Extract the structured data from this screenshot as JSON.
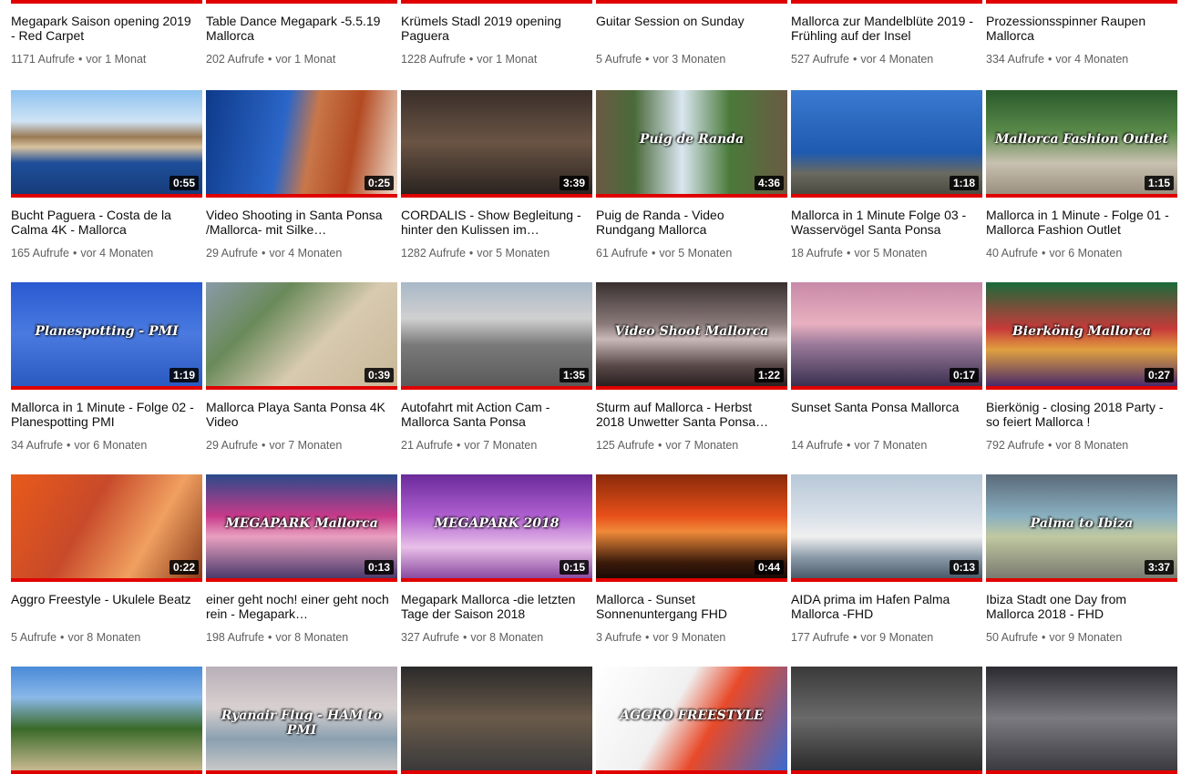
{
  "colors": {
    "progress_bar": "#e00000",
    "title_text": "#0d0d0d",
    "meta_text": "#606060"
  },
  "rows": [
    [
      {
        "title": "Megapark Saison opening 2019 - Red Carpet",
        "views": "1171 Aufrufe",
        "age": "vor 1 Monat",
        "duration": "",
        "bg": "linear-gradient(#333,#555)"
      },
      {
        "title": "Table Dance Megapark -5.5.19 Mallorca",
        "views": "202 Aufrufe",
        "age": "vor 1 Monat",
        "duration": "",
        "bg": "linear-gradient(#444,#666)"
      },
      {
        "title": "Krümels Stadl 2019 opening Paguera",
        "views": "1228 Aufrufe",
        "age": "vor 1 Monat",
        "duration": "",
        "bg": "linear-gradient(#3a2a20,#654)"
      },
      {
        "title": "Guitar Session on Sunday",
        "views": "5 Aufrufe",
        "age": "vor 3 Monaten",
        "duration": "",
        "bg": "linear-gradient(#2a2a2a,#555)"
      },
      {
        "title": "Mallorca zur Mandelblüte 2019 - Frühling auf der Insel",
        "views": "527 Aufrufe",
        "age": "vor 4 Monaten",
        "duration": "",
        "bg": "linear-gradient(#3a4a2a,#687)"
      },
      {
        "title": "Prozessionsspinner Raupen Mallorca",
        "views": "334 Aufrufe",
        "age": "vor 4 Monaten",
        "duration": "",
        "bg": "linear-gradient(#444,#776)"
      }
    ],
    [
      {
        "title": "Bucht Paguera - Costa de la Calma 4K - Mallorca",
        "views": "165 Aufrufe",
        "age": "vor 4 Monaten",
        "duration": "0:55",
        "overlay": "",
        "bg": "linear-gradient(#8ec2f0 0%,#cfe3f5 30%,#9a7a55 45%,#d8c2a0 55%,#1e4f9a 70%,#163c7a 100%)"
      },
      {
        "title": "Video Shooting in Santa Ponsa /Mallorca- mit Silke…",
        "views": "29 Aufrufe",
        "age": "vor 4 Monaten",
        "duration": "0:25",
        "overlay": "",
        "bg": "linear-gradient(100deg,#0e3a8a 0%,#2b66c8 40%,#c8774a 55%,#b34a22 75%,#f0e0d0 100%)"
      },
      {
        "title": "CORDALIS - Show Begleitung - hinter den Kulissen im…",
        "views": "1282 Aufrufe",
        "age": "vor 5 Monaten",
        "duration": "3:39",
        "overlay": "",
        "bg": "linear-gradient(#3a2f2a,#6a5444 50%,#2a2420)"
      },
      {
        "title": "Puig de Randa - Video Rundgang Mallorca",
        "views": "61 Aufrufe",
        "age": "vor 5 Monaten",
        "duration": "4:36",
        "overlay": "Puig de Randa",
        "bg": "linear-gradient(90deg,#6a5a44 0%,#4a6a3a 20%,#d9e6f0 45%,#4a7a3a 70%,#6a5a44 100%)"
      },
      {
        "title": "Mallorca in 1 Minute Folge 03 - Wasservögel Santa Ponsa",
        "views": "18 Aufrufe",
        "age": "vor 5 Monaten",
        "duration": "1:18",
        "overlay": "",
        "bg": "linear-gradient(#3a7ad0,#1e5ab0 60%,#6a6a60 80%,#4a4a40)"
      },
      {
        "title": "Mallorca in 1 Minute - Folge 01 - Mallorca Fashion Outlet",
        "views": "40 Aufrufe",
        "age": "vor 6 Monaten",
        "duration": "1:15",
        "overlay": "Mallorca Fashion Outlet",
        "bg": "linear-gradient(#2a5a2a,#5a8a4a 40%,#c8c0b0 70%,#9a9080)"
      }
    ],
    [
      {
        "title": "Mallorca in 1 Minute - Folge 02 - Planespotting PMI",
        "views": "34 Aufrufe",
        "age": "vor 6 Monaten",
        "duration": "1:19",
        "overlay": "Planespotting - PMI",
        "bg": "linear-gradient(#2a5ad0,#4a7ae0 50%,#2a5ac0)"
      },
      {
        "title": "Mallorca Playa Santa Ponsa 4K Video",
        "views": "29 Aufrufe",
        "age": "vor 7 Monaten",
        "duration": "0:39",
        "overlay": "",
        "bg": "linear-gradient(135deg,#8a9aa8 0%,#6a8a5a 30%,#d8cab0 60%,#c8b898 100%)"
      },
      {
        "title": "Autofahrt mit Action Cam - Mallorca Santa Ponsa",
        "views": "21 Aufrufe",
        "age": "vor 7 Monaten",
        "duration": "1:35",
        "overlay": "",
        "bg": "linear-gradient(#a8b8c8 0%,#d0d0d0 35%,#7a7a7a 60%,#5a5a5a 100%)"
      },
      {
        "title": "Sturm auf Mallorca - Herbst 2018 Unwetter Santa Ponsa…",
        "views": "125 Aufrufe",
        "age": "vor 7 Monaten",
        "duration": "1:22",
        "overlay": "Video Shoot Mallorca",
        "bg": "linear-gradient(#3a3030,#8a7a7a 40%,#c8b8b8 55%,#5a4a4a 80%,#2a2020)"
      },
      {
        "title": "Sunset Santa Ponsa Mallorca",
        "views": "14 Aufrufe",
        "age": "vor 7 Monaten",
        "duration": "0:17",
        "overlay": "",
        "bg": "linear-gradient(#c88aa8 0%,#e8b0c0 40%,#9a7a9a 60%,#3a3050 100%)"
      },
      {
        "title": "Bierkönig - closing 2018 Party - so feiert Mallorca !",
        "views": "792 Aufrufe",
        "age": "vor 8 Monaten",
        "duration": "0:27",
        "overlay": "Bierkönig Mallorca",
        "bg": "linear-gradient(#1a6a3a,#c83a3a 45%,#e0a040 65%,#4a2a6a)"
      }
    ],
    [
      {
        "title": "Aggro Freestyle - Ukulele Beatz",
        "views": "5 Aufrufe",
        "age": "vor 8 Monaten",
        "duration": "0:22",
        "overlay": "",
        "bg": "linear-gradient(120deg,#e85a1a 0%,#c84a2a 40%,#f0a060 70%,#8a3a1a 100%)"
      },
      {
        "title": "einer geht noch! einer geht noch rein - Megapark…",
        "views": "198 Aufrufe",
        "age": "vor 8 Monaten",
        "duration": "0:13",
        "overlay": "MEGAPARK Mallorca",
        "bg": "linear-gradient(#2a4a8a,#c83a8a 40%,#e8a0c0 60%,#4a3a6a)"
      },
      {
        "title": "Megapark Mallorca -die letzten Tage der Saison 2018",
        "views": "327 Aufrufe",
        "age": "vor 8 Monaten",
        "duration": "0:15",
        "overlay": "MEGAPARK 2018",
        "bg": "linear-gradient(#6a2a9a,#b060d0 40%,#e8c0e8 70%,#8a4aa0)"
      },
      {
        "title": "Mallorca - Sunset Sonnenuntergang FHD",
        "views": "3 Aufrufe",
        "age": "vor 9 Monaten",
        "duration": "0:44",
        "overlay": "",
        "bg": "linear-gradient(#8a2a0a 0%,#e8501a 40%,#f08a3a 55%,#3a1a0a 85%,#1a0a05 100%)"
      },
      {
        "title": "AIDA prima im Hafen Palma Mallorca -FHD",
        "views": "177 Aufrufe",
        "age": "vor 9 Monaten",
        "duration": "0:13",
        "overlay": "",
        "bg": "linear-gradient(#b8c8d8 0%,#d8e0e8 40%,#f0f0f0 60%,#8a9aa8 80%,#4a5a68 100%)"
      },
      {
        "title": "Ibiza Stadt one Day from Mallorca 2018 - FHD",
        "views": "50 Aufrufe",
        "age": "vor 9 Monaten",
        "duration": "3:37",
        "overlay": "Palma to Ibiza",
        "bg": "linear-gradient(#5a6a7a,#8ab0c0 40%,#c0c8a0 60%,#7a7a70)"
      }
    ],
    [
      {
        "title": "",
        "views": "",
        "age": "",
        "duration": "",
        "overlay": "",
        "bg": "linear-gradient(#4a8ad8,#8ab8e8 30%,#3a6a2a 60%,#c8b890)"
      },
      {
        "title": "",
        "views": "",
        "age": "",
        "duration": "",
        "overlay": "Ryanair Flug - HAM to PMI",
        "bg": "linear-gradient(#b8b0b8,#d8d0d0 40%,#8aa0b0 70%,#c8c8c8)"
      },
      {
        "title": "",
        "views": "",
        "age": "",
        "duration": "",
        "overlay": "",
        "bg": "linear-gradient(#2a2a2a,#6a5a4a 50%,#3a3a3a)"
      },
      {
        "title": "",
        "views": "",
        "age": "",
        "duration": "",
        "overlay": "AGGRO FREESTYLE",
        "bg": "linear-gradient(120deg,#ffffff 0%,#f0f0f0 40%,#e84a2a 60%,#3a6ad0 100%)"
      },
      {
        "title": "",
        "views": "",
        "age": "",
        "duration": "",
        "overlay": "",
        "bg": "linear-gradient(#3a3a3a,#6a6a6a 50%,#2a2a2a)"
      },
      {
        "title": "",
        "views": "",
        "age": "",
        "duration": "",
        "overlay": "",
        "bg": "linear-gradient(#2a2a30,#7a7a80 50%,#3a3a40)"
      }
    ]
  ]
}
